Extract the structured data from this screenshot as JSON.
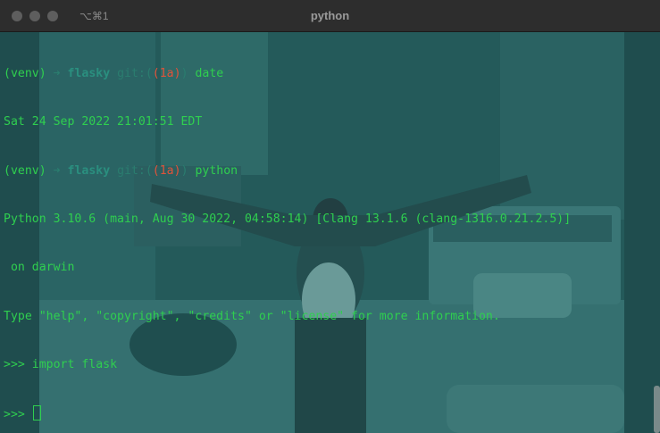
{
  "window": {
    "title": "python",
    "shortcut": "⌥⌘1",
    "colors": {
      "background": "#1f4d4e",
      "text_green": "#2fcf4f",
      "branch_red": "#e0533a",
      "dim_teal": "#2a7d6f"
    }
  },
  "terminal": {
    "line1": {
      "venv": "(venv)",
      "arrow": "➜",
      "dir": "flasky",
      "git_open": "git:(",
      "branch": "(1a)",
      "git_close": ")",
      "cmd": "date"
    },
    "line2": "Sat 24 Sep 2022 21:01:51 EDT",
    "line3": {
      "venv": "(venv)",
      "arrow": "➜",
      "dir": "flasky",
      "git_open": "git:(",
      "branch": "(1a)",
      "git_close": ")",
      "cmd": "python"
    },
    "line4": "Python 3.10.6 (main, Aug 30 2022, 04:58:14) [Clang 13.1.6 (clang-1316.0.21.2.5)]",
    "line5": " on darwin",
    "line6": "Type \"help\", \"copyright\", \"credits\" or \"license\" for more information.",
    "line7": ">>> import flask",
    "line8": ">>> "
  }
}
